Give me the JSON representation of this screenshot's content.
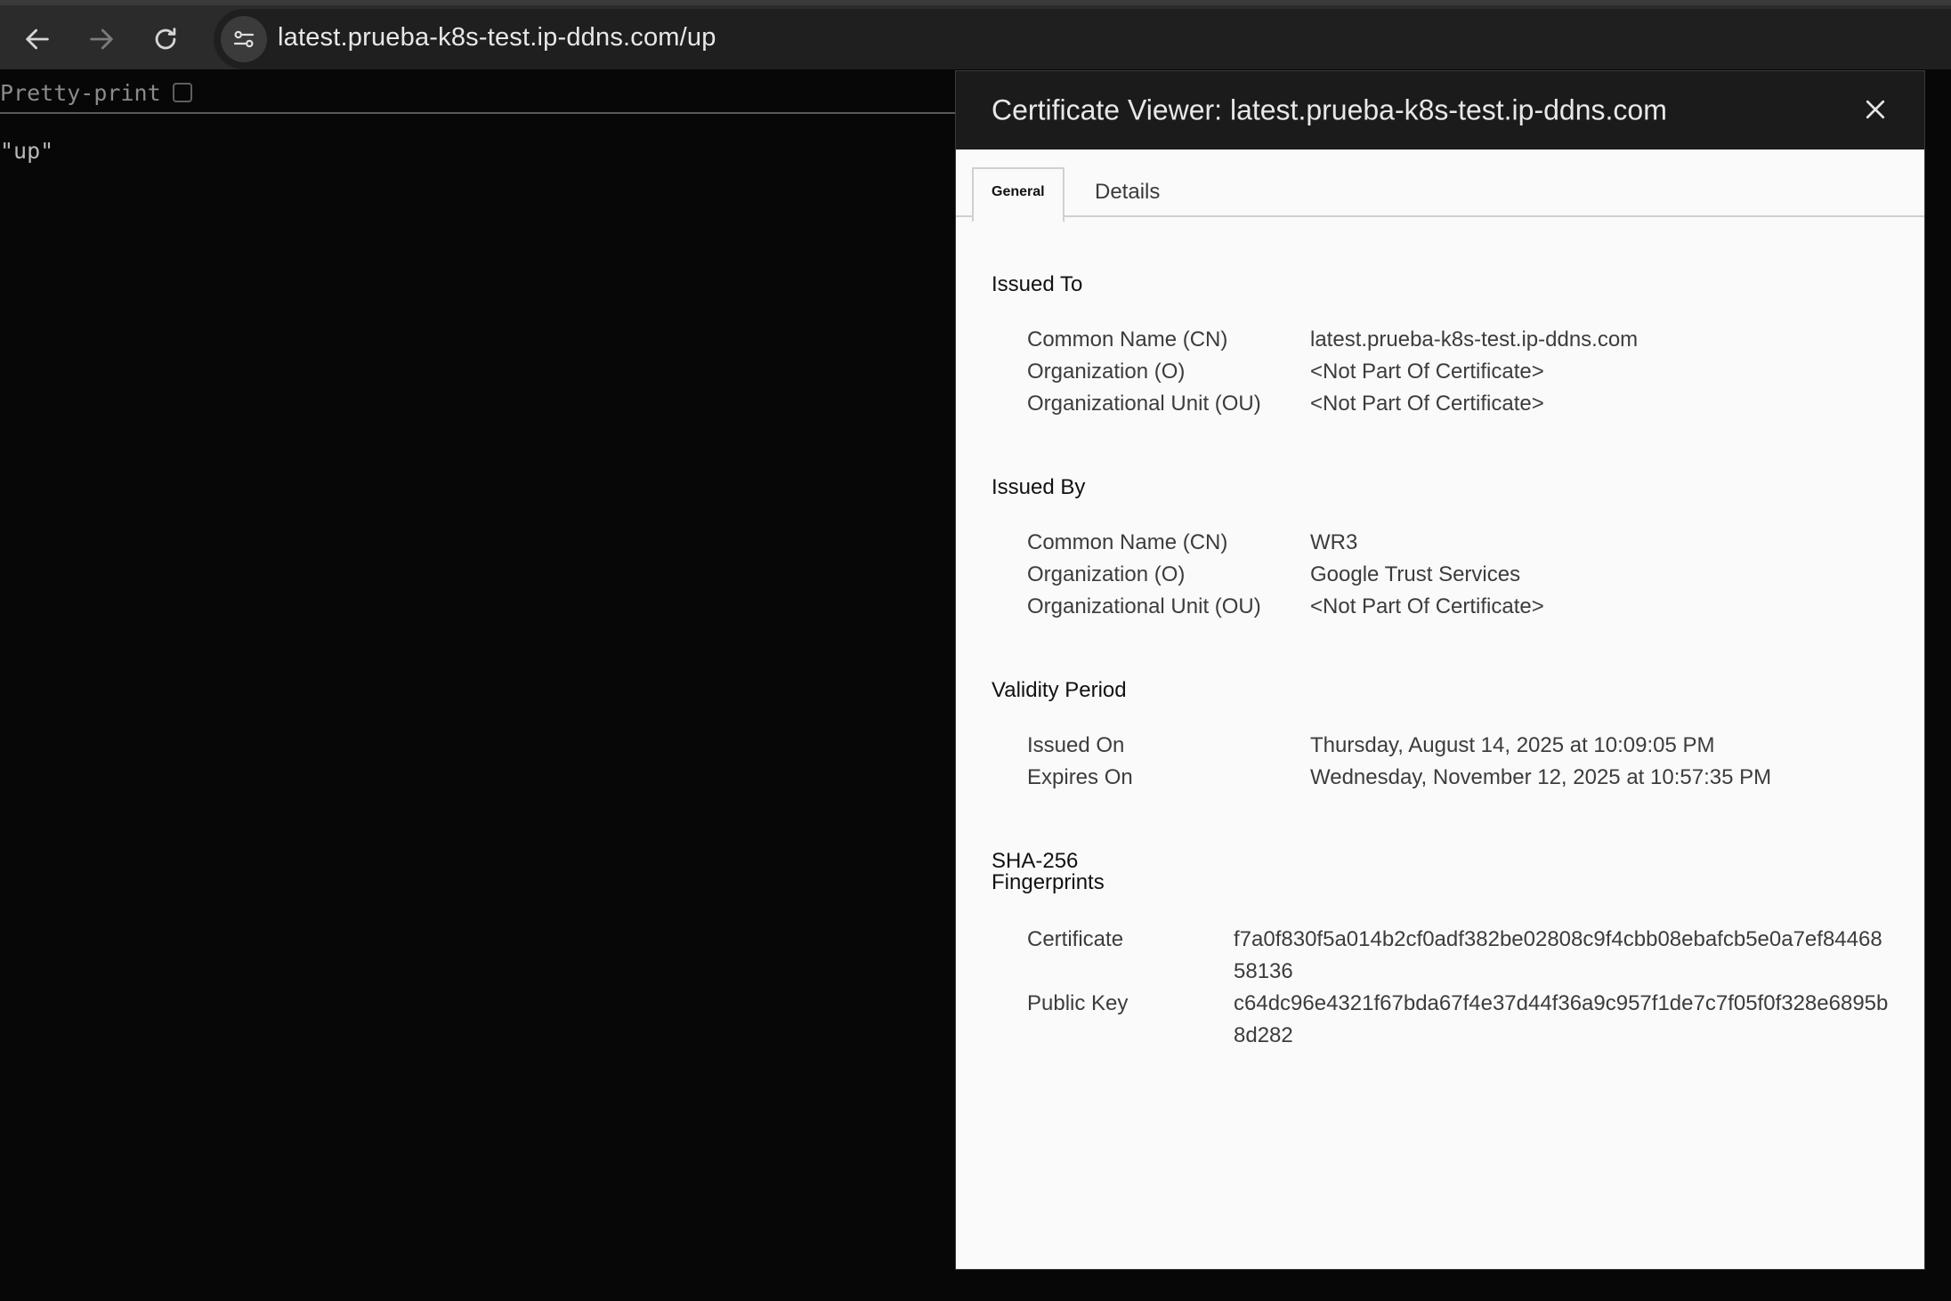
{
  "browser": {
    "url": "latest.prueba-k8s-test.ip-ddns.com/up"
  },
  "page": {
    "pretty_print_label": "Pretty-print",
    "body_text": "\"up\""
  },
  "certificate_viewer": {
    "title": "Certificate Viewer: latest.prueba-k8s-test.ip-ddns.com",
    "tabs": [
      "General",
      "Details"
    ],
    "active_tab": "General",
    "issued_to": {
      "heading": "Issued To",
      "rows": [
        {
          "label": "Common Name (CN)",
          "value": "latest.prueba-k8s-test.ip-ddns.com"
        },
        {
          "label": "Organization (O)",
          "value": "<Not Part Of Certificate>"
        },
        {
          "label": "Organizational Unit (OU)",
          "value": "<Not Part Of Certificate>"
        }
      ]
    },
    "issued_by": {
      "heading": "Issued By",
      "rows": [
        {
          "label": "Common Name (CN)",
          "value": "WR3"
        },
        {
          "label": "Organization (O)",
          "value": "Google Trust Services"
        },
        {
          "label": "Organizational Unit (OU)",
          "value": "<Not Part Of Certificate>"
        }
      ]
    },
    "validity": {
      "heading": "Validity Period",
      "rows": [
        {
          "label": "Issued On",
          "value": "Thursday, August 14, 2025 at 10:09:05 PM"
        },
        {
          "label": "Expires On",
          "value": "Wednesday, November 12, 2025 at 10:57:35 PM"
        }
      ]
    },
    "fingerprints": {
      "heading_line1": "SHA-256",
      "heading_line2": "Fingerprints",
      "rows": [
        {
          "label": "Certificate",
          "value": "f7a0f830f5a014b2cf0adf382be02808c9f4cbb08ebafcb5e0a7ef8446858136"
        },
        {
          "label": "Public Key",
          "value": "c64dc96e4321f67bda67f4e37d44f36a9c957f1de7c7f05f0f328e6895b8d282"
        }
      ]
    }
  },
  "icons": {
    "back": "arrow-left-icon",
    "forward": "arrow-right-icon",
    "reload": "reload-icon",
    "site_info": "tune-icon",
    "close": "close-icon"
  }
}
